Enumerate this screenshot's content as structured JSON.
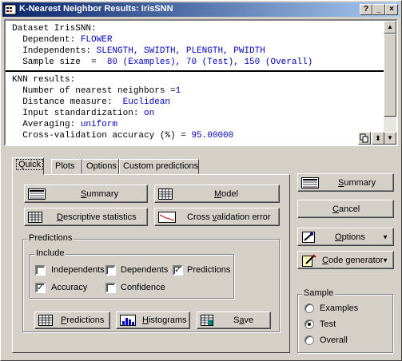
{
  "window": {
    "title": "K-Nearest Neighbor Results: IrisSNN",
    "help_btn": "?",
    "min_btn": "_",
    "max_btn": "□",
    "close_btn": "×"
  },
  "summary_text": {
    "lines1": [
      {
        "label": "Dataset IrisSNN:",
        "value": ""
      },
      {
        "label": "  Dependent: ",
        "value": "FLOWER"
      },
      {
        "label": "  Independents: ",
        "value": "SLENGTH, SWIDTH, PLENGTH, PWIDTH"
      },
      {
        "label": "  Sample size  =  ",
        "value": "80 (Examples), 70 (Test), 150 (Overall)"
      }
    ],
    "lines2": [
      {
        "label": "KNN results:",
        "value": ""
      },
      {
        "label": "  Number of nearest neighbors =",
        "value": "1"
      },
      {
        "label": "  Distance measure:  ",
        "value": "Euclidean"
      },
      {
        "label": "  Input standardization: ",
        "value": "on"
      },
      {
        "label": "  Averaging: ",
        "value": "uniform"
      },
      {
        "label": "  Cross-validation accuracy (%) = ",
        "value": "95.00000"
      }
    ]
  },
  "scroll": {
    "up": "▲",
    "down": "▼",
    "expand": "⬍"
  },
  "tabs": [
    "Quick",
    "Plots",
    "Options",
    "Custom predictions"
  ],
  "quick": {
    "summary": {
      "pre": "",
      "u": "S",
      "post": "ummary"
    },
    "model": {
      "pre": "",
      "u": "M",
      "post": "odel"
    },
    "descriptive": {
      "pre": "",
      "u": "D",
      "post": "escriptive statistics"
    },
    "cross": {
      "pre": "Cross ",
      "u": "v",
      "post": "alidation error"
    },
    "predictions_group": "Predictions",
    "include_group": "Include",
    "checks": [
      {
        "label": "Independents",
        "checked": false
      },
      {
        "label": "Dependents",
        "checked": false
      },
      {
        "label": "Predictions",
        "checked": true
      },
      {
        "label": "Accuracy",
        "checked": true
      },
      {
        "label": "Confidence",
        "checked": false
      }
    ],
    "pred_btn": {
      "pre": "",
      "u": "P",
      "post": "redictions"
    },
    "hist_btn": {
      "pre": "",
      "u": "H",
      "post": "istograms"
    },
    "save_btn": {
      "pre": "S",
      "u": "a",
      "post": "ve"
    }
  },
  "right": {
    "summary": {
      "pre": "",
      "u": "S",
      "post": "ummary"
    },
    "cancel": {
      "pre": "",
      "u": "C",
      "post": "ancel"
    },
    "options": {
      "pre": "",
      "u": "O",
      "post": "ptions"
    },
    "codegen": {
      "pre": "",
      "u": "C",
      "post": "ode generator"
    },
    "sample_group": "Sample",
    "samples": [
      {
        "label": "Examples",
        "selected": false
      },
      {
        "label": "Test",
        "selected": true
      },
      {
        "label": "Overall",
        "selected": false
      }
    ]
  },
  "checkmark": "✓",
  "dropdown_arrow": "▼"
}
